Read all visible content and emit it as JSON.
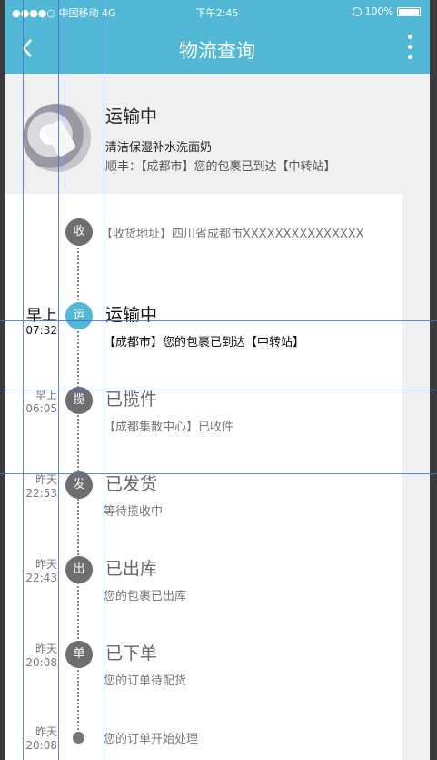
{
  "status_bar": {
    "signal": "●●●●○ 中国移动 4G",
    "time": "下午2:45",
    "battery": "100%"
  },
  "nav": {
    "title": "物流查询",
    "back_icon": "chevron-left-icon",
    "more_icon": "more-vertical-icon"
  },
  "summary": {
    "status": "运输中",
    "product": "清洁保湿补水洗面奶",
    "carrier_info": "顺丰：【成都市】您的包裹已到达【中转站】"
  },
  "timeline": {
    "address": "【收货地址】四川省成都市XXXXXXXXXXXXXXX",
    "address_badge": "收",
    "events": [
      {
        "badge": "运",
        "day": "早上",
        "time": "07:32",
        "title": "运输中",
        "detail": "【成都市】您的包裹已到达【中转站】",
        "active": true
      },
      {
        "badge": "揽",
        "day": "早上",
        "time": "06:05",
        "title": "已揽件",
        "detail": "【成都集散中心】已收件",
        "active": false
      },
      {
        "badge": "发",
        "day": "昨天",
        "time": "22:53",
        "title": "已发货",
        "detail": "等待揽收中",
        "active": false
      },
      {
        "badge": "出",
        "day": "昨天",
        "time": "22:43",
        "title": "已出库",
        "detail": "您的包裹已出库",
        "active": false
      },
      {
        "badge": "单",
        "day": "昨天",
        "time": "20:08",
        "title": "已下单",
        "detail": "您的订单待配货",
        "active": false
      },
      {
        "badge": "",
        "day": "昨天",
        "time": "20:08",
        "title": "",
        "detail": "您的订单开始处理",
        "active": false
      }
    ]
  },
  "colors": {
    "accent": "#52b8d6",
    "node": "#6e6e6e",
    "guide": "#4a6fd6"
  }
}
